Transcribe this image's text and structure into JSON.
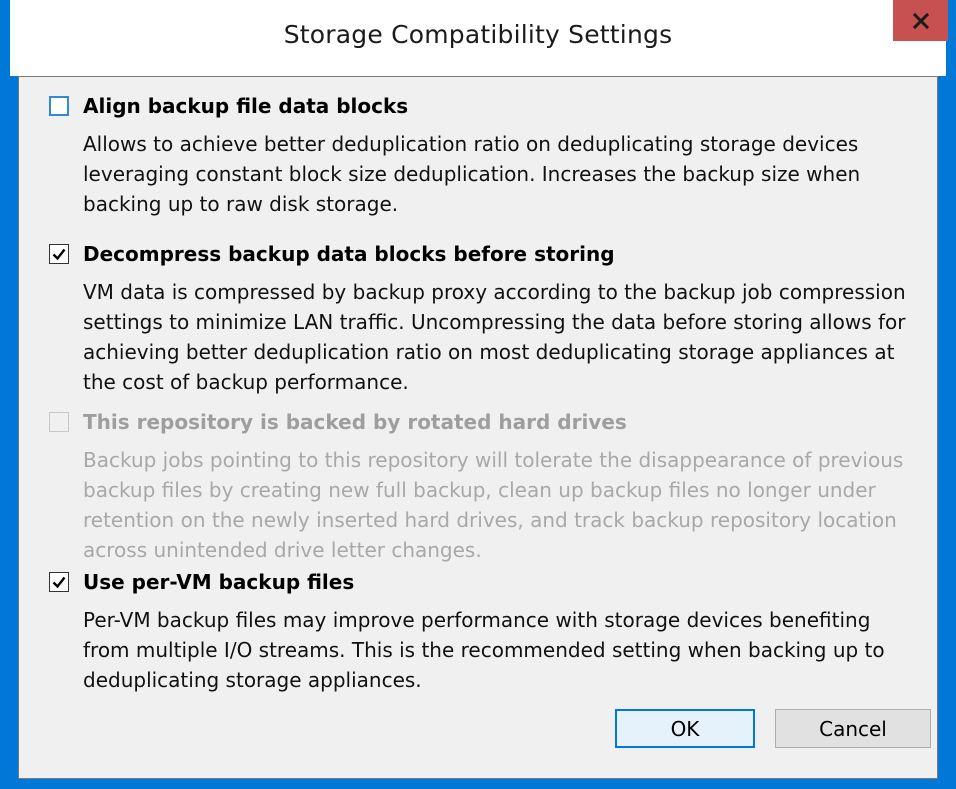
{
  "window": {
    "title": "Storage Compatibility Settings",
    "close_glyph": "x"
  },
  "options": [
    {
      "label": "Align backup file data blocks",
      "checked": false,
      "enabled": true,
      "description": "Allows to achieve better deduplication ratio on deduplicating storage devices leveraging constant block size deduplication. Increases the backup size when backing up to raw disk storage."
    },
    {
      "label": "Decompress backup data blocks before storing",
      "checked": true,
      "enabled": true,
      "description": "VM data is compressed by backup proxy according to the backup job compression settings to minimize LAN traffic. Uncompressing the data before storing allows for achieving better deduplication ratio on most deduplicating storage appliances at the cost of backup performance."
    },
    {
      "label": "This repository is backed by rotated hard drives",
      "checked": false,
      "enabled": false,
      "description": "Backup jobs pointing to this repository will tolerate the disappearance of previous backup files by creating new full backup, clean up backup files no longer under retention on the newly inserted hard drives, and track backup repository location across unintended drive letter changes."
    },
    {
      "label": "Use per-VM backup files",
      "checked": true,
      "enabled": true,
      "description": "Per-VM backup files may improve performance with storage devices benefiting from multiple I/O streams. This is the recommended setting when backing up to deduplicating storage appliances."
    }
  ],
  "buttons": {
    "ok_label": "OK",
    "cancel_label": "Cancel"
  },
  "colors": {
    "accent": "#0078d7",
    "close": "#c75050"
  }
}
